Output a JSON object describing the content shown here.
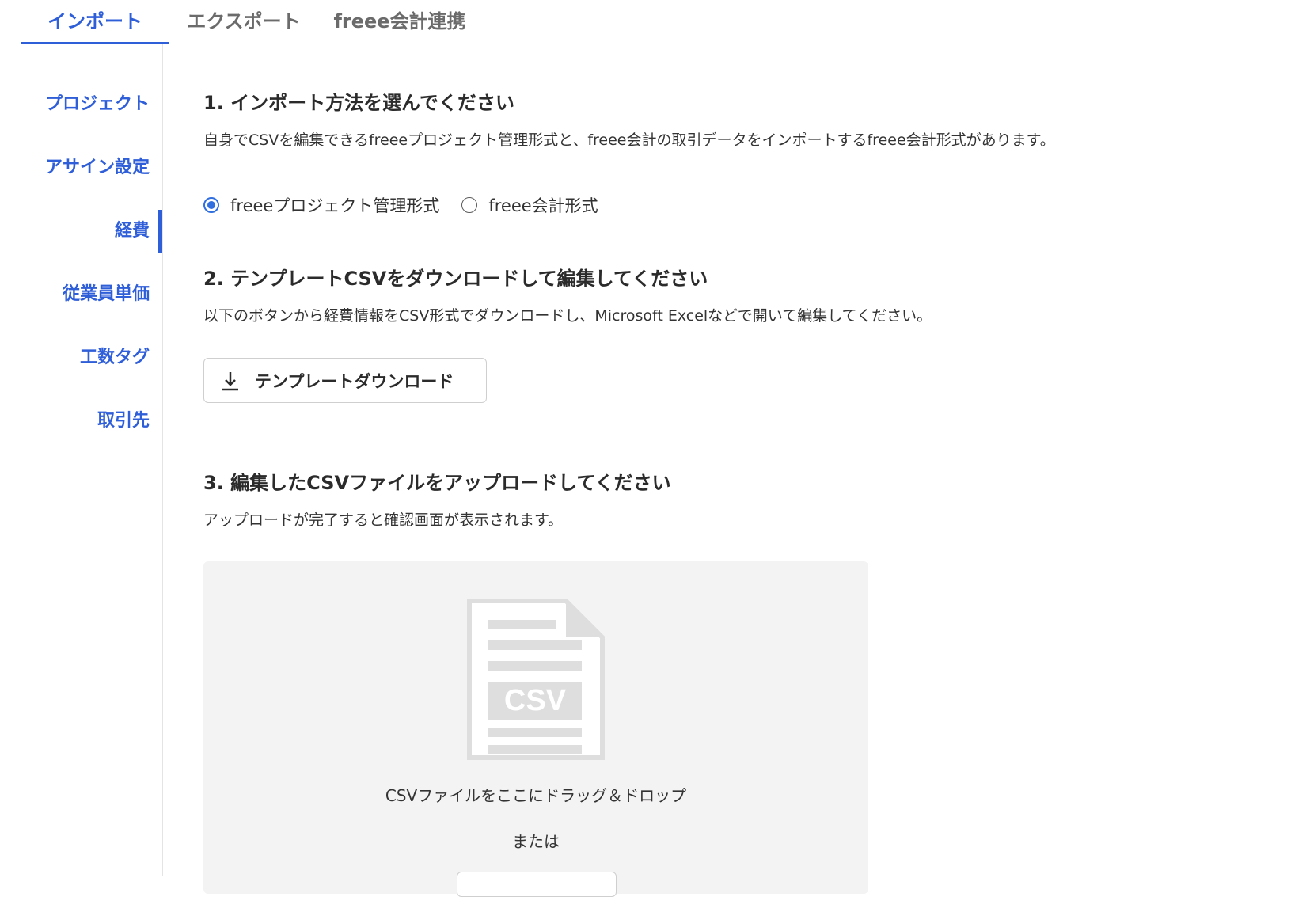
{
  "tabs": [
    {
      "label": "インポート",
      "active": true
    },
    {
      "label": "エクスポート",
      "active": false
    },
    {
      "label": "freee会計連携",
      "active": false
    }
  ],
  "sidebar": {
    "items": [
      {
        "label": "プロジェクト",
        "active": false
      },
      {
        "label": "アサイン設定",
        "active": false
      },
      {
        "label": "経費",
        "active": true
      },
      {
        "label": "従業員単価",
        "active": false
      },
      {
        "label": "工数タグ",
        "active": false
      },
      {
        "label": "取引先",
        "active": false
      }
    ]
  },
  "step1": {
    "heading": "1. インポート方法を選んでください",
    "description": "自身でCSVを編集できるfreeeプロジェクト管理形式と、freee会計の取引データをインポートするfreee会計形式があります。",
    "options": [
      {
        "label": "freeeプロジェクト管理形式",
        "selected": true
      },
      {
        "label": "freee会計形式",
        "selected": false
      }
    ]
  },
  "step2": {
    "heading": "2. テンプレートCSVをダウンロードして編集してください",
    "description": "以下のボタンから経費情報をCSV形式でダウンロードし、Microsoft Excelなどで開いて編集してください。",
    "button_label": "テンプレートダウンロード",
    "button_icon": "download-icon"
  },
  "step3": {
    "heading": "3. 編集したCSVファイルをアップロードしてください",
    "description": "アップロードが完了すると確認画面が表示されます。",
    "dropzone": {
      "illustration_text": "CSV",
      "drag_text": "CSVファイルをここにドラッグ＆ドロップ",
      "or_text": "または"
    }
  },
  "colors": {
    "accent": "#2f5ed9",
    "radio": "#2f6fe0",
    "dropzone_bg": "#f4f3f3",
    "illustration": "#dedede"
  }
}
